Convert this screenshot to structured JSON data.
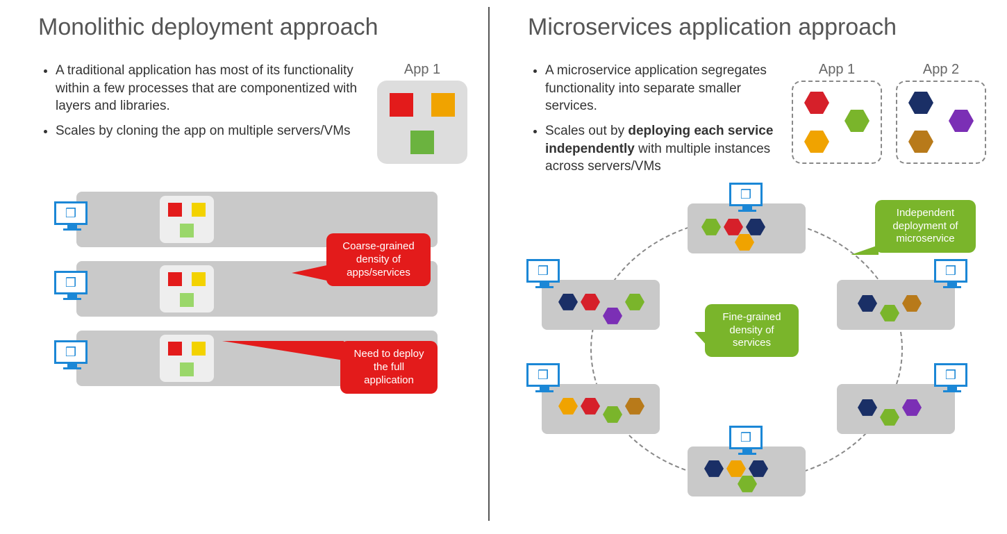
{
  "left": {
    "heading": "Monolithic deployment approach",
    "bullets": [
      "A traditional application has most of its functionality within a few processes that are componentized with layers and libraries.",
      "Scales by cloning the app on multiple servers/VMs"
    ],
    "app1_label": "App 1",
    "callout_density": "Coarse-grained density of apps/services",
    "callout_deploy": "Need to deploy the full application"
  },
  "right": {
    "heading": "Microservices application approach",
    "bullets": [
      "A microservice application segregates functionality into separate smaller services.",
      "Scales out by <b>deploying each service independently</b> with multiple instances across servers/VMs"
    ],
    "app1_label": "App 1",
    "app2_label": "App 2",
    "callout_density": "Fine-grained density of services",
    "callout_independent": "Independent deployment of microservice"
  },
  "colors": {
    "blue_icon": "#1b87d6",
    "callout_red": "#e31b1b",
    "callout_green": "#7ab52b",
    "server_grey": "#c9c9c9",
    "hex_red": "#d6202a",
    "hex_orange": "#f0a300",
    "hex_green": "#7ab52b",
    "hex_navy": "#1a2f66",
    "hex_purple": "#7b2fb5",
    "hex_brown": "#b87a1a"
  }
}
